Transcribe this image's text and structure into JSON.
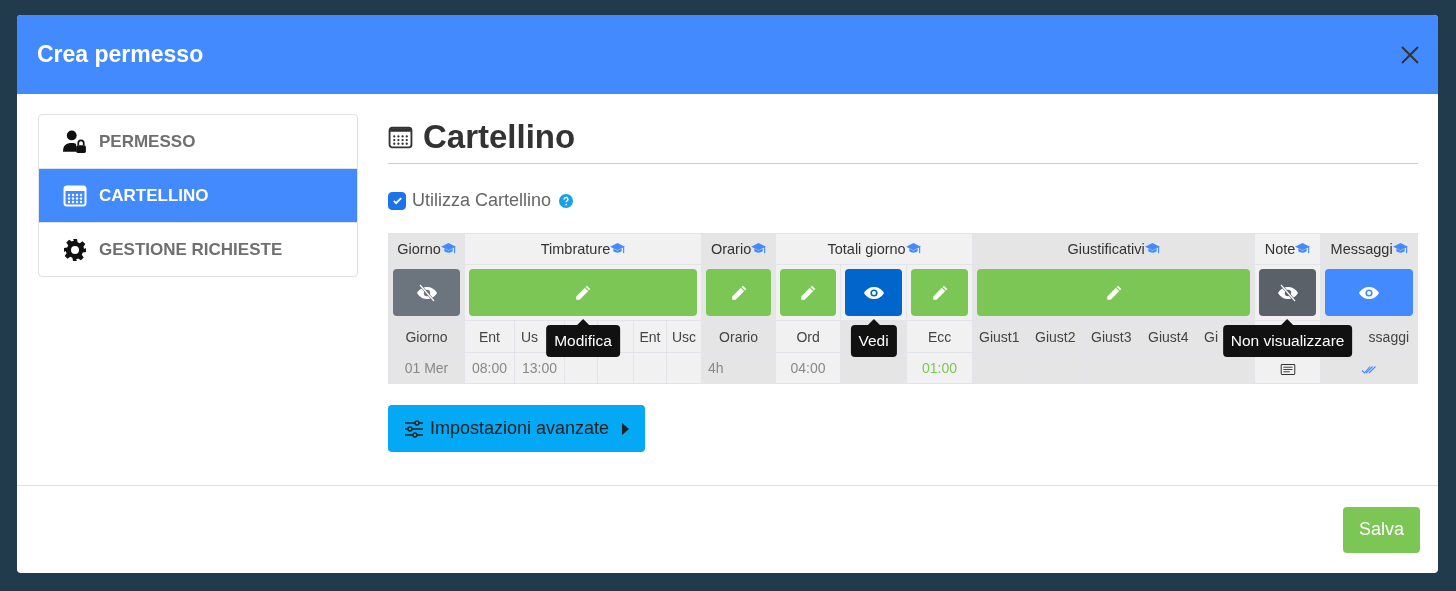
{
  "modal": {
    "title": "Crea permesso"
  },
  "sidebar": {
    "items": [
      {
        "label": "PERMESSO",
        "selected": false
      },
      {
        "label": "CARTELLINO",
        "selected": true
      },
      {
        "label": "GESTIONE RICHIESTE",
        "selected": false
      }
    ]
  },
  "section": {
    "title": "Cartellino"
  },
  "use_checkbox": {
    "label": "Utilizza Cartellino",
    "checked": true
  },
  "table": {
    "groups": [
      {
        "title": "Giorno",
        "shaded": true,
        "buttons": [
          {
            "kind": "hide"
          }
        ],
        "columns": [
          {
            "label": "Giorno",
            "value": "01 Mer"
          }
        ]
      },
      {
        "title": "Timbrature",
        "shaded": false,
        "buttons": [
          {
            "kind": "edit",
            "tooltip": "Modifica"
          }
        ],
        "columns": [
          {
            "label": "Ent",
            "value": "08:00"
          },
          {
            "label": "Us",
            "value": "13:00"
          },
          {},
          {},
          {
            "label": "Ent"
          },
          {
            "label": "Usc"
          }
        ]
      },
      {
        "title": "Orario",
        "shaded": true,
        "buttons": [
          {
            "kind": "edit"
          }
        ],
        "columns": [
          {
            "label": "Orario",
            "value": "4h"
          }
        ]
      },
      {
        "title": "Totali giorno",
        "shaded": false,
        "buttons": [
          {
            "kind": "edit"
          },
          {
            "kind": "view",
            "tooltip": "Vedi"
          },
          {
            "kind": "edit"
          }
        ],
        "columns": [
          {
            "label": "Ord",
            "value": "04:00"
          },
          {
            "shaded": true
          },
          {
            "label": "Ecc",
            "value": "01:00",
            "highlight": true
          }
        ]
      },
      {
        "title": "Giustificativi",
        "shaded": true,
        "buttons": [
          {
            "kind": "edit"
          }
        ],
        "columns": [
          {
            "label": "Giust1"
          },
          {
            "label": "Giust2"
          },
          {
            "label": "Giust3"
          },
          {
            "label": "Giust4"
          },
          {
            "label": "Gi"
          }
        ]
      },
      {
        "title": "Note",
        "shaded": false,
        "buttons": [
          {
            "kind": "hide-dark",
            "tooltip": "Non visualizzare"
          }
        ],
        "columns": [
          {}
        ]
      },
      {
        "title": "Messaggi",
        "shaded": true,
        "buttons": [
          {
            "kind": "view-light"
          }
        ],
        "columns": [
          {
            "label": "ssaggi"
          }
        ]
      }
    ]
  },
  "advanced_button": {
    "label": "Impostazioni avanzate"
  },
  "save_button": {
    "label": "Salva"
  }
}
